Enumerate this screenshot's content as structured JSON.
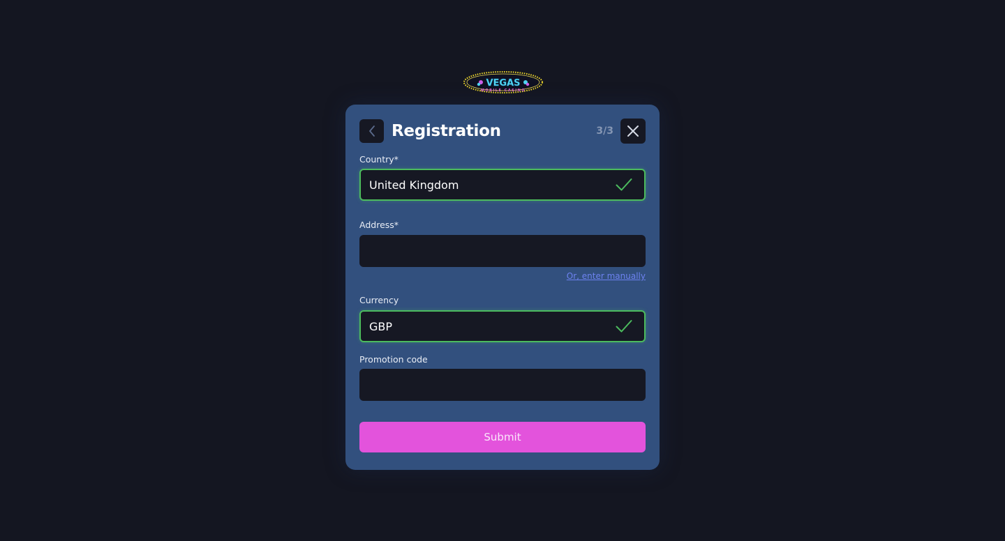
{
  "logo": {
    "text_main": "VEGAS",
    "text_sub": "MOBILE CASINO"
  },
  "header": {
    "title": "Registration",
    "step": "3/3",
    "back_icon": "chevron-left-icon",
    "close_icon": "close-icon"
  },
  "form": {
    "country": {
      "label": "Country*",
      "value": "United Kingdom",
      "status": "valid"
    },
    "address": {
      "label": "Address*",
      "value": "",
      "manual_link": "Or, enter manually"
    },
    "currency": {
      "label": "Currency",
      "value": "GBP",
      "status": "valid"
    },
    "promotion": {
      "label": "Promotion code",
      "value": ""
    },
    "submit_label": "Submit"
  },
  "colors": {
    "page_bg": "#141621",
    "modal_bg": "#32507e",
    "field_bg": "#161823",
    "valid_green": "#4cbc5e",
    "link": "#6d82f0",
    "submit_bg": "#e353dc"
  }
}
